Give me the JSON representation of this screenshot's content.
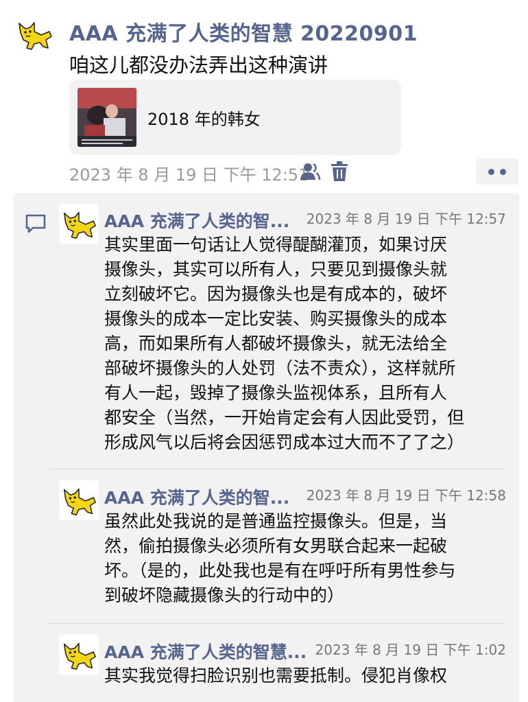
{
  "post": {
    "author_name": "AAA 充满了人类的智慧 20220901",
    "text": "咱这儿都没办法弄出这种演讲",
    "link_card": {
      "title": "2018 年的韩女"
    },
    "time": "2023 年 8 月 19 日  下午 12:51"
  },
  "comments": [
    {
      "author_name": "AAA 充满了人类的智...",
      "time": "2023 年 8 月 19 日  下午 12:57",
      "lines": [
        "其实里面一句话让人觉得醍醐灌顶，如果讨厌",
        "摄像头，其实可以所有人，只要见到摄像头就",
        "立刻破坏它。因为摄像头也是有成本的，破坏",
        "摄像头的成本一定比安装、购买摄像头的成本",
        "高，而如果所有人都破坏摄像头，就无法给全",
        "部破坏摄像头的人处罚（法不责众），这样就所",
        "有人一起，毁掉了摄像头监视体系，且所有人",
        "都安全（当然，一开始肯定会有人因此受罚，但",
        "形成风气以后将会因惩罚成本过大而不了了之）"
      ]
    },
    {
      "author_name": "AAA 充满了人类的智...",
      "time": "2023 年 8 月 19 日  下午 12:58",
      "lines": [
        "虽然此处我说的是普通监控摄像头。但是，当",
        "然，偷拍摄像头必须所有女男联合起来一起破",
        "坏。（是的，此处我也是有在呼吁所有男性参与",
        "到破坏隐藏摄像头的行动中的）"
      ]
    },
    {
      "author_name": "AAA 充满了人类的智慧...",
      "time": "2023 年 8 月 19 日  下午 1:02",
      "lines": [
        "其实我觉得扫脸识别也需要抵制。侵犯肖像权"
      ]
    }
  ],
  "icons": {
    "visibility": "people-icon",
    "delete": "trash-icon",
    "more": "more-dots-icon",
    "comment": "comment-bubble-icon"
  },
  "colors": {
    "name_link": "#56658f",
    "timestamp": "#9a9a9a",
    "comment_bg": "#f2f2f2",
    "avatar_cat": "#f5d614"
  }
}
